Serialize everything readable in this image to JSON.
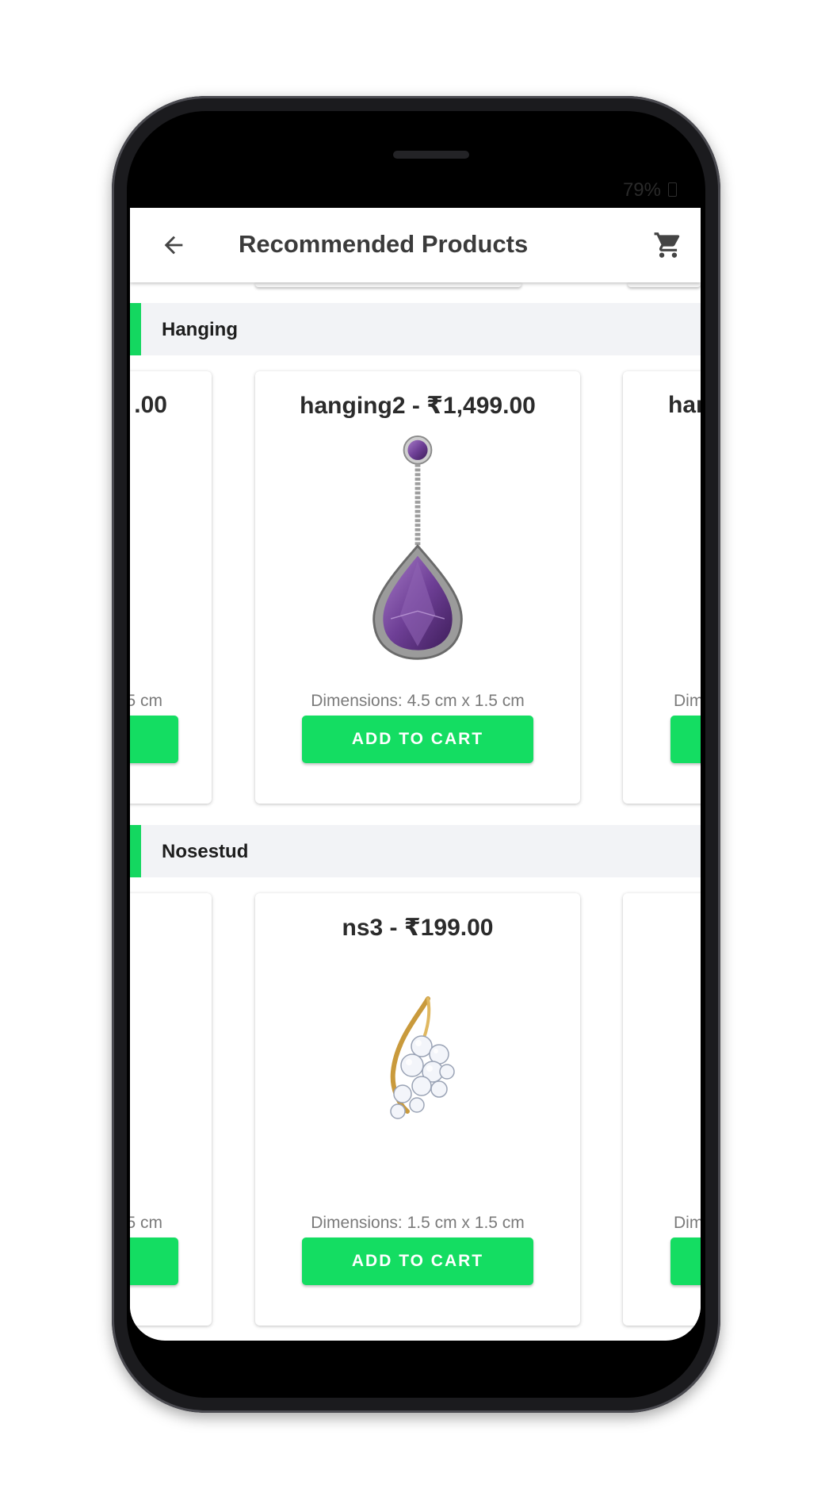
{
  "status_bar": {
    "battery": "79%"
  },
  "app_bar": {
    "title": "Recommended Products",
    "back_icon": "arrow-back-icon",
    "cart_icon": "shopping-cart-icon"
  },
  "sections": [
    {
      "title": "Hanging",
      "products": [
        {
          "title": ".00",
          "dimensions": "5 cm",
          "button": ""
        },
        {
          "title": "hanging2 - ₹1,499.00",
          "dimensions": "Dimensions: 4.5 cm x 1.5 cm",
          "button": "ADD TO CART",
          "image": "purple-teardrop-hanging-image"
        },
        {
          "title": "han",
          "dimensions": "Dim",
          "button": ""
        }
      ]
    },
    {
      "title": "Nosestud",
      "products": [
        {
          "title": "",
          "dimensions": "5 cm",
          "button": ""
        },
        {
          "title": "ns3 - ₹199.00",
          "dimensions": "Dimensions: 1.5 cm x 1.5 cm",
          "button": "ADD TO CART",
          "image": "diamond-flower-nosestud-image"
        },
        {
          "title": "",
          "dimensions": "Dim",
          "button": ""
        }
      ]
    }
  ],
  "colors": {
    "accent": "#14dd62",
    "header_bg": "#f2f3f6"
  }
}
